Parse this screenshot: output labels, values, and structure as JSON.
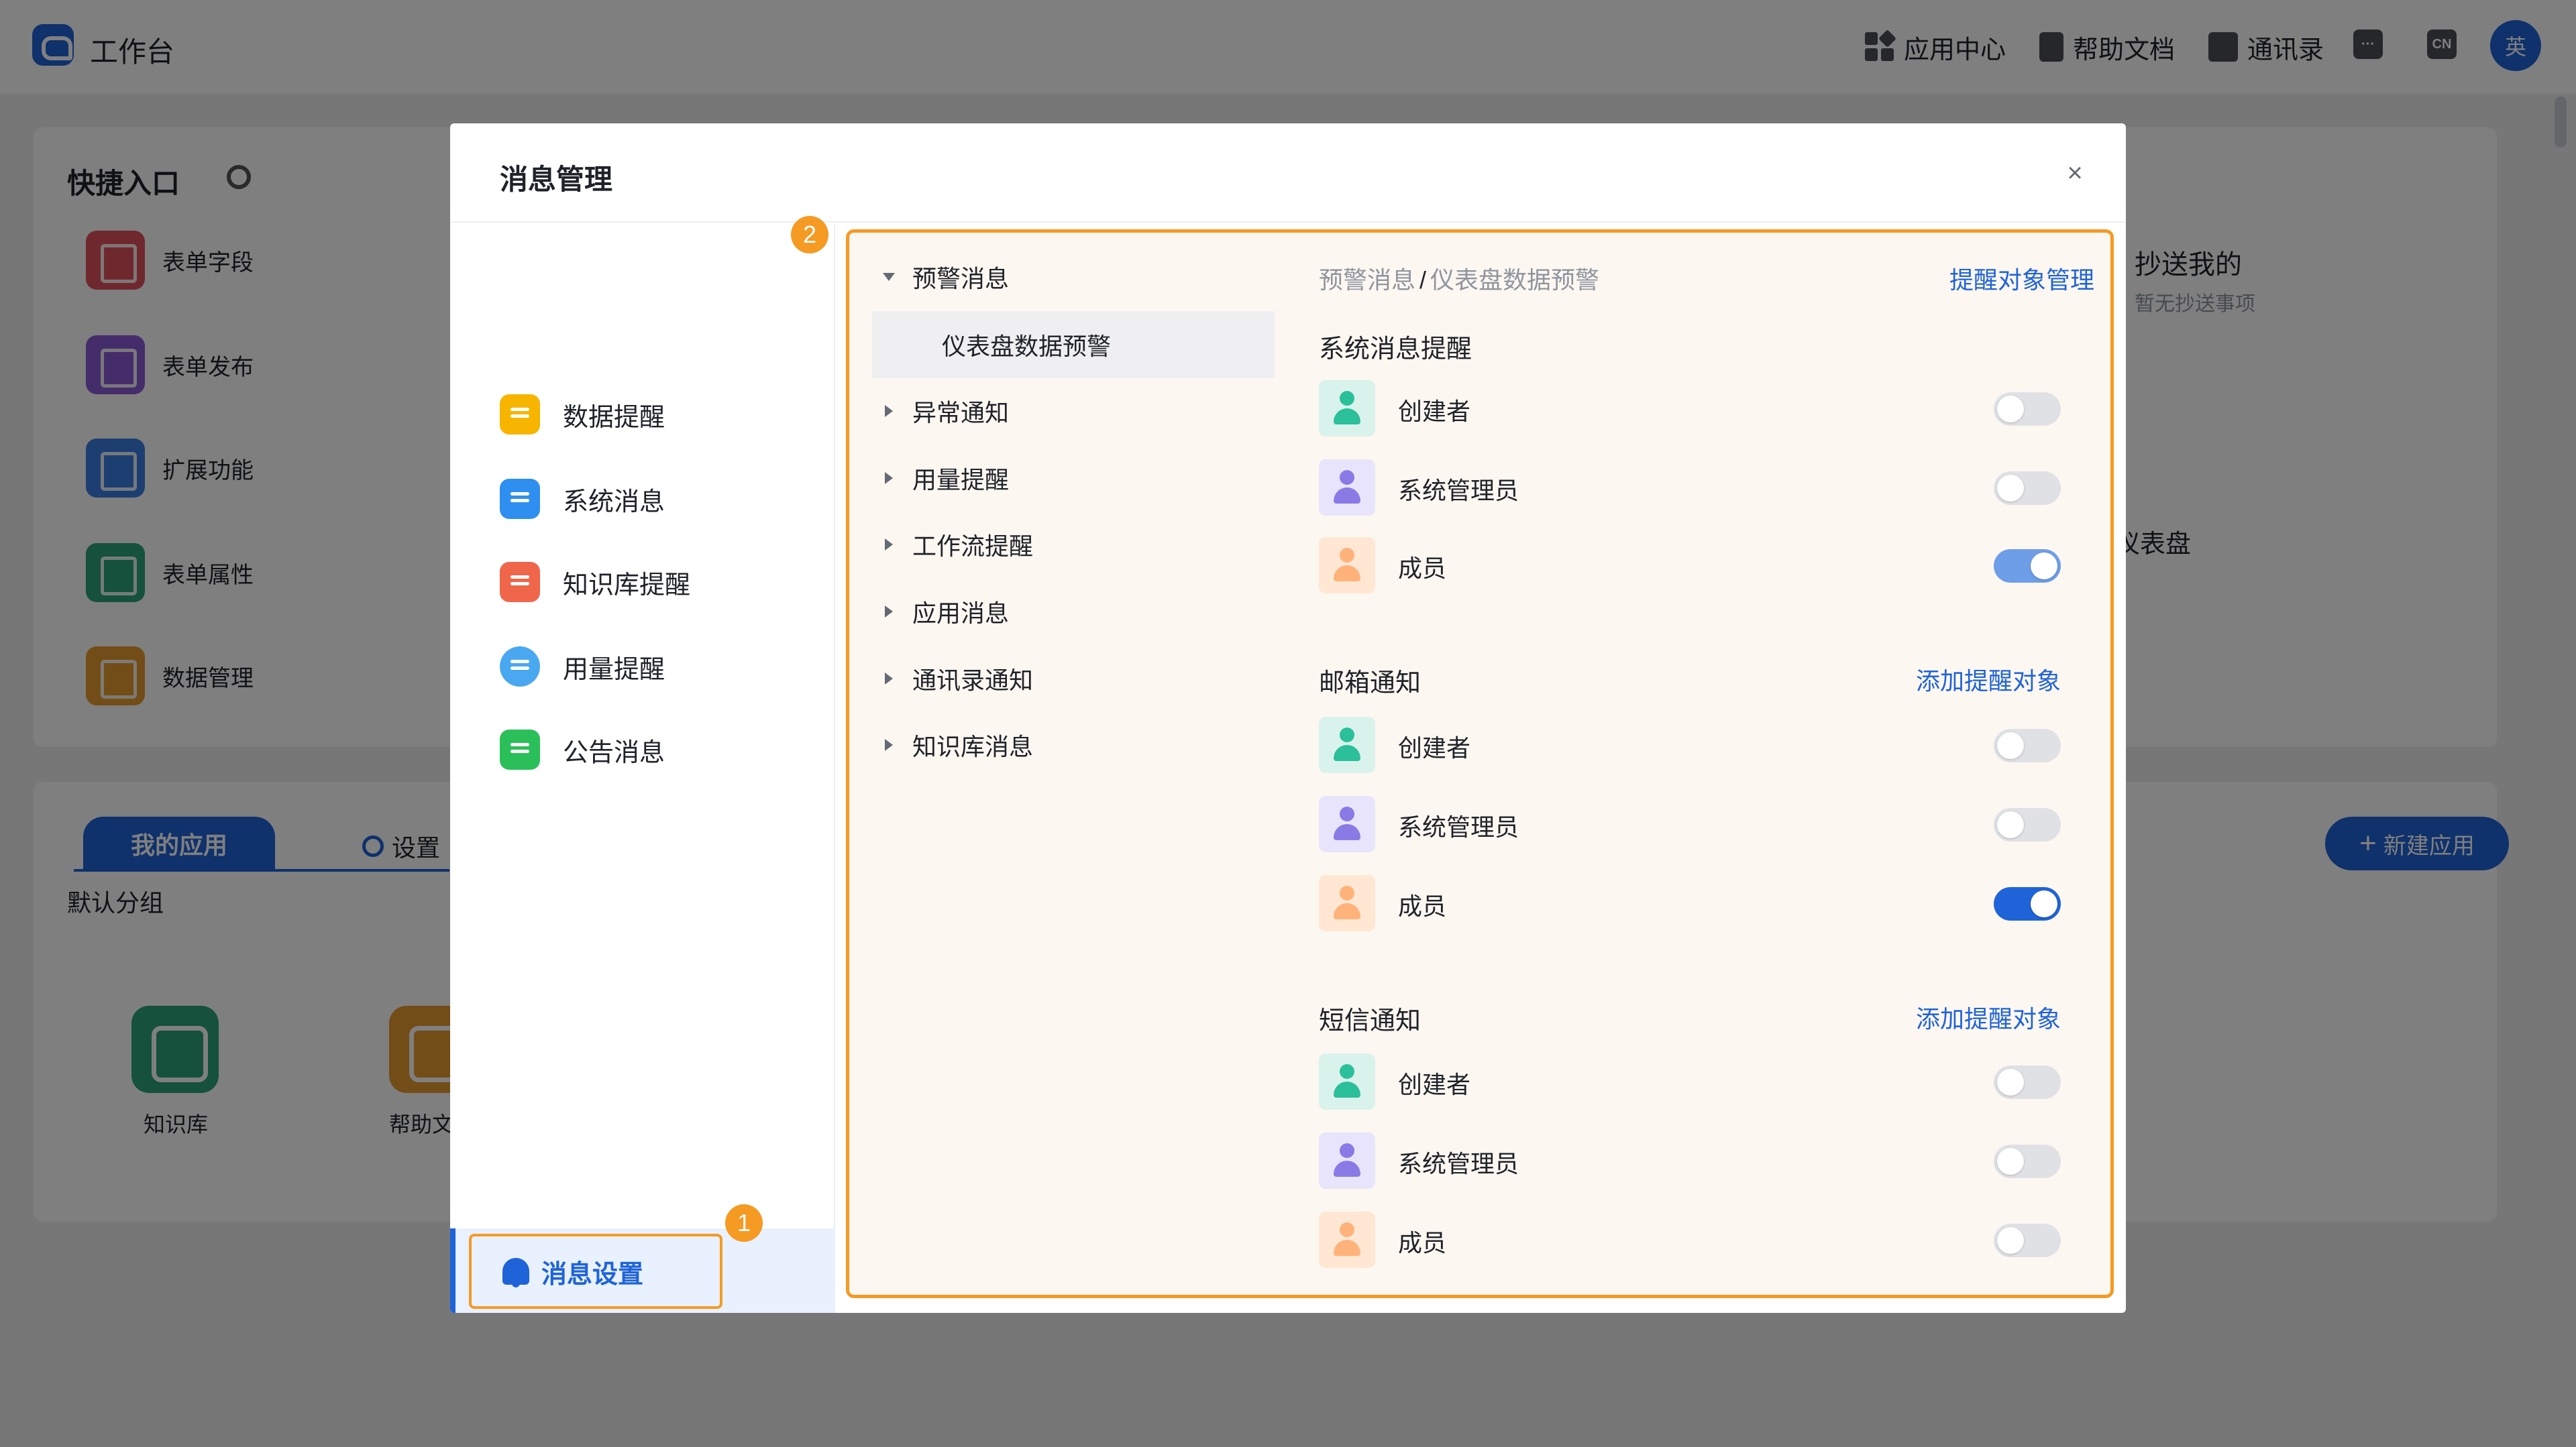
{
  "app": {
    "title": "工作台",
    "nav": [
      {
        "label": "应用中心",
        "icon": "grid-icon"
      },
      {
        "label": "帮助文档",
        "icon": "document-icon"
      },
      {
        "label": "通讯录",
        "icon": "contacts-icon"
      }
    ],
    "lang_badge": "CN",
    "user_avatar": "英"
  },
  "quick_entry": {
    "title": "快捷入口",
    "items": [
      {
        "label": "表单字段",
        "color": "#e0505f"
      },
      {
        "label": "表单发布",
        "color": "#8b5bd6"
      },
      {
        "label": "扩展功能",
        "color": "#3a7de0"
      },
      {
        "label": "表单属性",
        "color": "#2ba37a"
      },
      {
        "label": "数据管理",
        "color": "#e79a2f"
      }
    ]
  },
  "cc_card": {
    "title": "抄送我的",
    "subtitle": "暂无抄送事项"
  },
  "dashboard_partial": "仪表盘",
  "my_apps": {
    "tab_active": "我的应用",
    "tab_settings": "设置",
    "group": "默认分组",
    "new_app": "新建应用",
    "apps": [
      {
        "label": "知识库",
        "color": "#2ba37a"
      },
      {
        "label": "帮助文",
        "color": "#e79a2f"
      }
    ]
  },
  "modal": {
    "title": "消息管理",
    "categories": [
      {
        "label": "数据提醒",
        "color": "#f7b500"
      },
      {
        "label": "系统消息",
        "color": "#2f8ff0"
      },
      {
        "label": "知识库提醒",
        "color": "#f0664a"
      },
      {
        "label": "用量提醒",
        "color": "#4aa8f0"
      },
      {
        "label": "公告消息",
        "color": "#2bbf5a"
      }
    ],
    "settings_button": "消息设置",
    "badges": [
      "1",
      "2"
    ],
    "tree": {
      "expanded": "预警消息",
      "selected_child": "仪表盘数据预警",
      "collapsed": [
        "异常通知",
        "用量提醒",
        "工作流提醒",
        "应用消息",
        "通讯录通知",
        "知识库消息"
      ]
    },
    "breadcrumb": {
      "parent": "预警消息",
      "sep": "/",
      "current": "仪表盘数据预警"
    },
    "manage_link": "提醒对象管理",
    "sections": [
      {
        "title": "系统消息提醒",
        "add_link": "",
        "rows": [
          {
            "label": "创建者",
            "on": false
          },
          {
            "label": "系统管理员",
            "on": false
          },
          {
            "label": "成员",
            "on": true
          }
        ]
      },
      {
        "title": "邮箱通知",
        "add_link": "添加提醒对象",
        "rows": [
          {
            "label": "创建者",
            "on": false
          },
          {
            "label": "系统管理员",
            "on": false
          },
          {
            "label": "成员",
            "on": true
          }
        ]
      },
      {
        "title": "短信通知",
        "add_link": "添加提醒对象",
        "rows": [
          {
            "label": "创建者",
            "on": false
          },
          {
            "label": "系统管理员",
            "on": false
          },
          {
            "label": "成员",
            "on": false
          }
        ]
      }
    ]
  }
}
